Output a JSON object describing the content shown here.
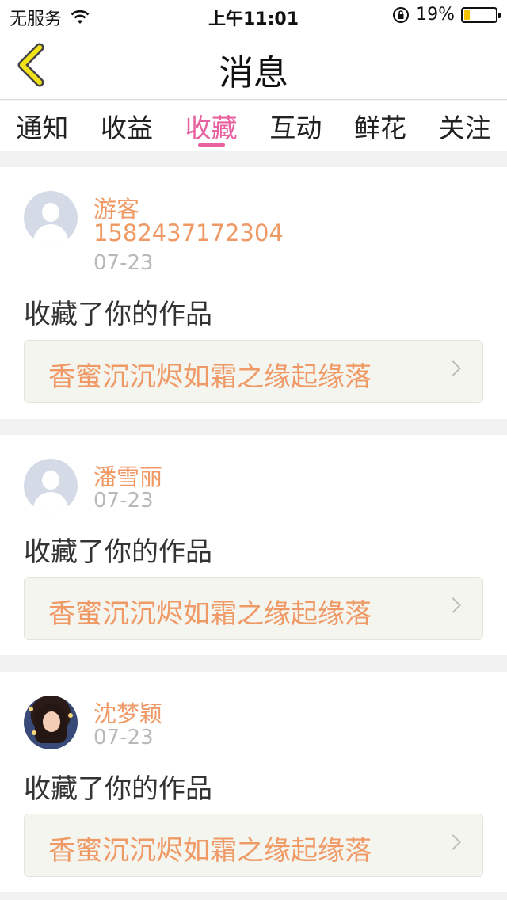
{
  "status_bar": {
    "carrier": "无服务",
    "time": "上午11:01",
    "battery_percent": "19%",
    "battery_level": 0.19
  },
  "nav": {
    "title": "消息"
  },
  "tabs": [
    {
      "label": "通知",
      "active": false
    },
    {
      "label": "收益",
      "active": false
    },
    {
      "label": "收藏",
      "active": true
    },
    {
      "label": "互动",
      "active": false
    },
    {
      "label": "鲜花",
      "active": false
    },
    {
      "label": "关注",
      "active": false
    }
  ],
  "colors": {
    "accent": "#e8609f",
    "username": "#ef9a66",
    "date": "#b8b8b8"
  },
  "messages": [
    {
      "name": "游客",
      "phone": "1582437172304",
      "date": "07-23",
      "action": "收藏了你的作品",
      "work_title": "香蜜沉沉烬如霜之缘起缘落",
      "avatar": "default-avatar-icon"
    },
    {
      "name": "潘雪丽",
      "date": "07-23",
      "action": "收藏了你的作品",
      "work_title": "香蜜沉沉烬如霜之缘起缘落",
      "avatar": "default-avatar-icon"
    },
    {
      "name": "沈梦颖",
      "date": "07-23",
      "action": "收藏了你的作品",
      "work_title": "香蜜沉沉烬如霜之缘起缘落",
      "avatar": "user-photo"
    }
  ]
}
